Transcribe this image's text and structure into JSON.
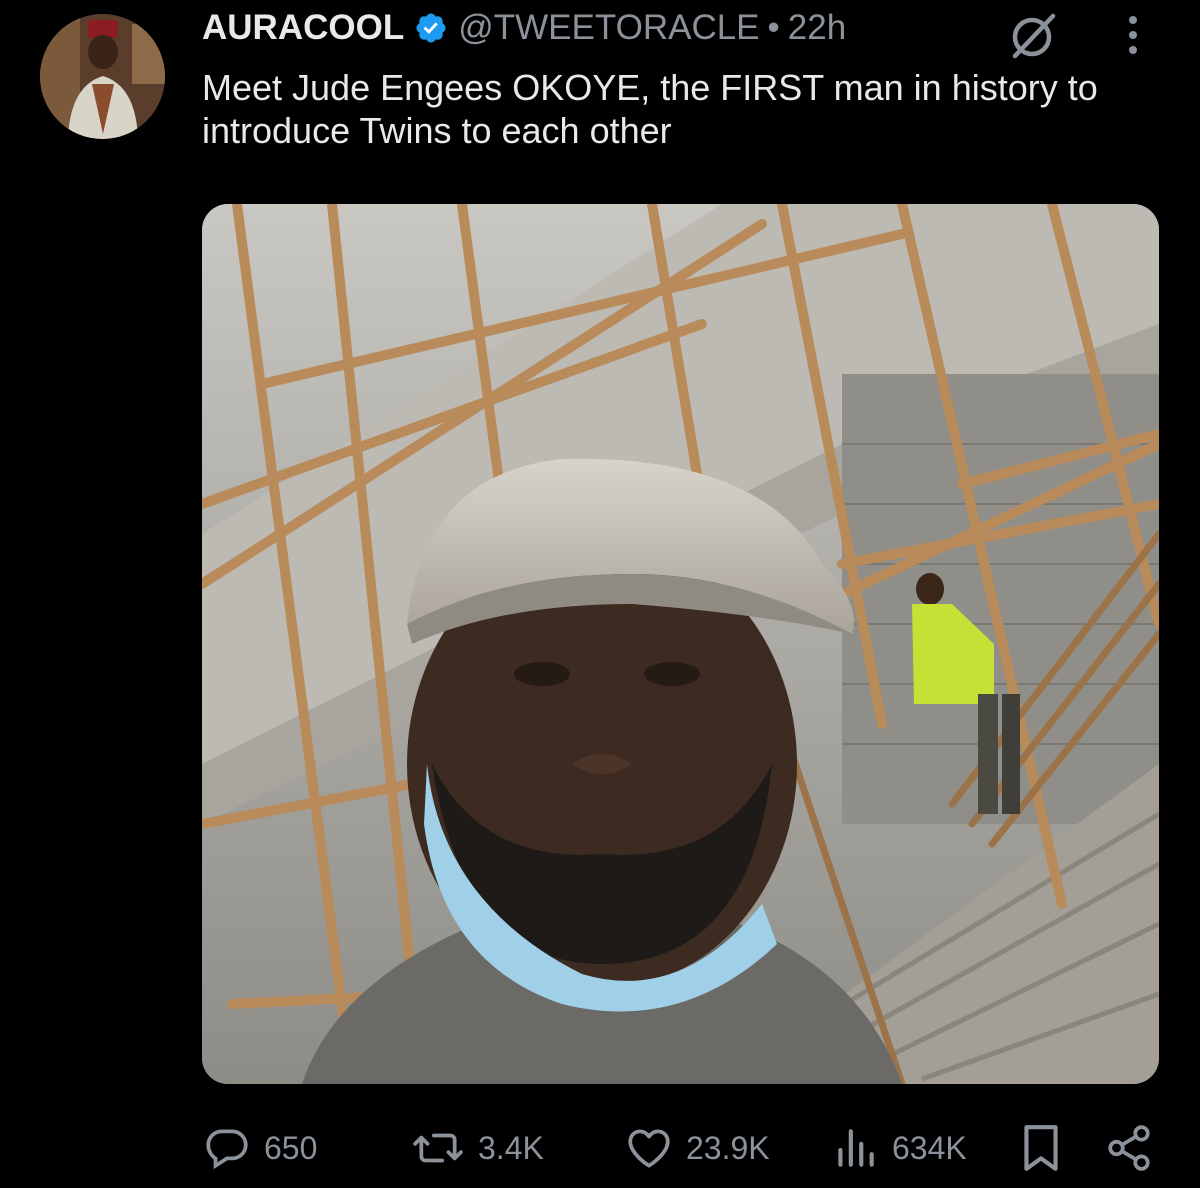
{
  "author": {
    "display_name": "AURACOOL",
    "handle": "@TWEETORACLE",
    "separator": "•",
    "time": "22h",
    "verified": true
  },
  "tweet": {
    "text": "Meet Jude Engees OKOYE, the FIRST man in history to introduce Twins to each other"
  },
  "actions": {
    "replies": "650",
    "reposts": "3.4K",
    "likes": "23.9K",
    "views": "634K"
  },
  "icons": {
    "verified": "verified-badge-icon",
    "grok": "grok-icon",
    "more": "more-options-icon",
    "reply": "reply-icon",
    "repost": "repost-icon",
    "like": "heart-icon",
    "views": "views-chart-icon",
    "bookmark": "bookmark-icon",
    "share": "share-icon"
  },
  "colors": {
    "background": "#000000",
    "text": "#e7e9ea",
    "secondary": "#8b9299",
    "verified": "#1d9bf0"
  }
}
